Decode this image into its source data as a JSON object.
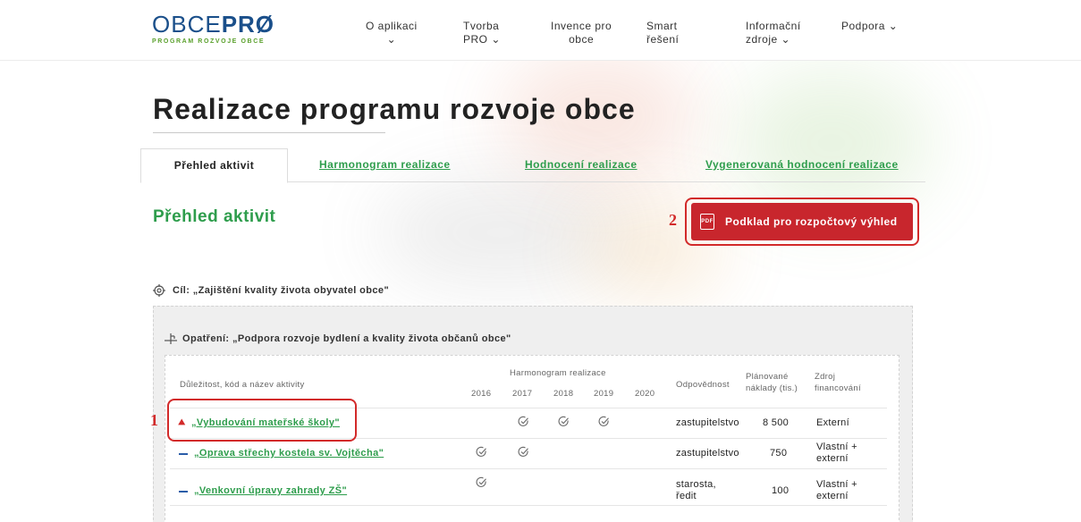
{
  "header": {
    "logo": {
      "main_light": "OBCE",
      "main_bold": "PRØ",
      "sub": "PROGRAM ROZVOJE OBCE"
    },
    "nav": [
      {
        "line1": "O aplikaci",
        "line2": "⌄"
      },
      {
        "line1": "Tvorba",
        "line2": "PRO ⌄"
      },
      {
        "line1": "Invence pro",
        "line2": "obce"
      },
      {
        "line1": "Smart",
        "line2": "řešení"
      },
      {
        "line1": "Informační",
        "line2": "zdroje ⌄"
      },
      {
        "line1": "Podpora ⌄",
        "line2": ""
      }
    ]
  },
  "page_title": "Realizace programu rozvoje obce",
  "tabs": [
    {
      "label": "Přehled aktivit",
      "active": true
    },
    {
      "label": "Harmonogram realizace",
      "active": false
    },
    {
      "label": "Hodnocení realizace",
      "active": false
    },
    {
      "label": "Vygenerovaná hodnocení realizace",
      "active": false
    }
  ],
  "section_title": "Přehled aktivit",
  "pdf_button": {
    "icon_text": "PDF",
    "label": "Podklad pro rozpočtový výhled"
  },
  "annotations": {
    "one": "1",
    "two": "2"
  },
  "goal": "Cíl: „Zajištění kvality života obyvatel obce\"",
  "measure": "Opatření: „Podpora rozvoje bydlení a kvality života občanů obce\"",
  "table": {
    "headers": {
      "activity": "Důležitost, kód a název aktivity",
      "schedule": "Harmonogram realizace",
      "years": [
        "2016",
        "2017",
        "2018",
        "2019",
        "2020"
      ],
      "responsible": "Odpovědnost",
      "cost_line1": "Plánované",
      "cost_line2": "náklady (tis.)",
      "source_line1": "Zdroj",
      "source_line2": "financování"
    },
    "rows": [
      {
        "priority": "high",
        "name": "„Vybudování mateřské školy\"",
        "checks": [
          false,
          true,
          true,
          true,
          false
        ],
        "responsible_l1": "zastupitelstvo",
        "responsible_l2": "",
        "cost": "8 500",
        "source_l1": "Externí",
        "source_l2": ""
      },
      {
        "priority": "medium",
        "name": "„Oprava střechy kostela sv. Vojtěcha\"",
        "checks": [
          true,
          true,
          false,
          false,
          false
        ],
        "responsible_l1": "zastupitelstvo",
        "responsible_l2": "",
        "cost": "750",
        "source_l1": "Vlastní +",
        "source_l2": "externí"
      },
      {
        "priority": "medium",
        "name": "„Venkovní úpravy zahrady ZŠ\"",
        "checks": [
          true,
          false,
          false,
          false,
          false
        ],
        "responsible_l1": "starosta,",
        "responsible_l2": "ředit",
        "cost": "100",
        "source_l1": "Vlastní +",
        "source_l2": "externí"
      }
    ]
  },
  "colors": {
    "accent_green": "#2e9d4c",
    "danger_red": "#c8262d",
    "annotation_red": "#d22a2a",
    "brand_blue": "#1a4f8a"
  }
}
